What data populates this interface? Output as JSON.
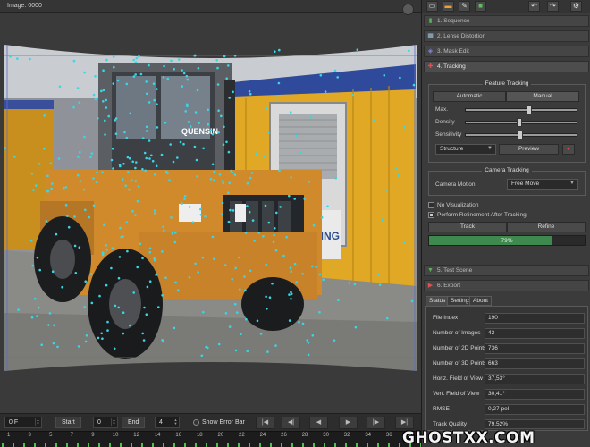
{
  "viewer": {
    "title": "Image: 0000"
  },
  "controls": {
    "frame_value": "0 F",
    "start_label": "Start",
    "start_value": "0",
    "end_label": "End",
    "end_value": "4",
    "error_bar_label": "Show Error Bar",
    "nav_icons": [
      "skip-to-start-icon",
      "step-back-icon",
      "play-backward-icon",
      "play-forward-icon",
      "step-forward-icon",
      "skip-to-end-icon"
    ]
  },
  "timeline": {
    "ticks": [
      "1",
      "3",
      "5",
      "7",
      "9",
      "10",
      "12",
      "14",
      "16",
      "18",
      "20",
      "22",
      "24",
      "26",
      "28",
      "30",
      "32",
      "34",
      "36",
      "38"
    ]
  },
  "toolbar": {
    "icons": [
      "new-file-icon",
      "open-folder-icon",
      "edit-icon",
      "save-icon",
      "undo-icon",
      "redo-icon",
      "settings-icon"
    ]
  },
  "steps": {
    "sequence": "1. Sequence",
    "lens": "2. Lense Distortion",
    "mask": "3. Mask Edit",
    "tracking": "4. Tracking",
    "test": "5. Test Scene",
    "export": "6. Export"
  },
  "feature_tracking": {
    "title": "Feature Tracking",
    "automatic": "Automatic",
    "manual": "Manual",
    "max_label": "Max.",
    "max_level": 0.58,
    "density_label": "Density",
    "density_level": 0.48,
    "sensitivity_label": "Sensitivity",
    "sensitivity_level": 0.49,
    "structure_value": "Structure",
    "preview": "Preview"
  },
  "camera_tracking": {
    "title": "Camera Tracking",
    "motion_label": "Camera Motion",
    "motion_value": "Free Move"
  },
  "options": {
    "no_visualization": "No Visualization",
    "refinement": "Perform Refinement After Tracking"
  },
  "actions": {
    "track": "Track",
    "refine": "Refine"
  },
  "progress": {
    "text": "79%",
    "value": 0.79
  },
  "tabs": {
    "status": "Status",
    "settings": "Settings",
    "about": "About"
  },
  "status": {
    "file_index_label": "File Index",
    "file_index": "190",
    "images_label": "Number of Images",
    "images": "42",
    "points2d_label": "Number of 2D Points",
    "points2d": "736",
    "points3d_label": "Number of 3D Points",
    "points3d": "663",
    "hfov_label": "Horiz. Field of View",
    "hfov": "37,53°",
    "vfov_label": "Vert. Field of View",
    "vfov": "30,41°",
    "rmse_label": "RMSE",
    "rmse": "0,27 pel",
    "quality_label": "Track Quality",
    "quality": "79,52%"
  },
  "watermark": "GHOSTXX.COM",
  "colors": {
    "progress_fill": "#3e8a4e",
    "track_point": "#38d6e6",
    "timeline_marker": "#4ec24e"
  }
}
